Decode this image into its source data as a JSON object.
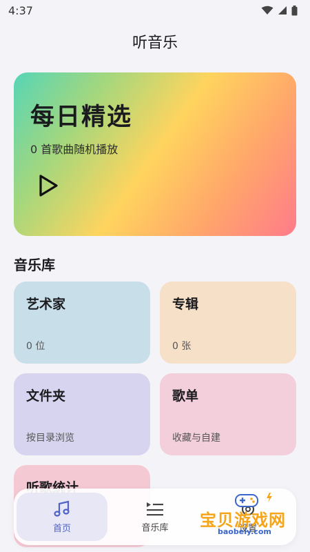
{
  "status_bar": {
    "time": "4:37",
    "icons": [
      "wifi-icon",
      "signal-icon",
      "battery-icon"
    ]
  },
  "header": {
    "title": "听音乐"
  },
  "hero": {
    "title": "每日精选",
    "subtitle": "0 首歌曲随机播放",
    "play_icon": "play-icon",
    "gradient_colors": [
      "#56d5b6",
      "#a6d77c",
      "#ffd45e",
      "#ffa56b",
      "#ff7b8a"
    ]
  },
  "library": {
    "title": "音乐库",
    "cards": [
      {
        "title": "艺术家",
        "subtitle": "0 位",
        "color": "#c8dfe9"
      },
      {
        "title": "专辑",
        "subtitle": "0 张",
        "color": "#f7e0c8"
      },
      {
        "title": "文件夹",
        "subtitle": "按目录浏览",
        "color": "#d6d4ee"
      },
      {
        "title": "歌单",
        "subtitle": "收藏与自建",
        "color": "#f2cfda"
      },
      {
        "title": "听歌统计",
        "subtitle": "",
        "color": "#f5c9d3"
      }
    ]
  },
  "bottom_nav": {
    "items": [
      {
        "label": "首页",
        "icon": "music-note-icon",
        "active": true
      },
      {
        "label": "音乐库",
        "icon": "list-icon",
        "active": false
      },
      {
        "label": "设置",
        "icon": "settings-icon",
        "active": false
      }
    ],
    "accent": "#4f63c7"
  },
  "watermark": {
    "brand": "宝贝游戏网",
    "url": "baobeiy.com"
  }
}
